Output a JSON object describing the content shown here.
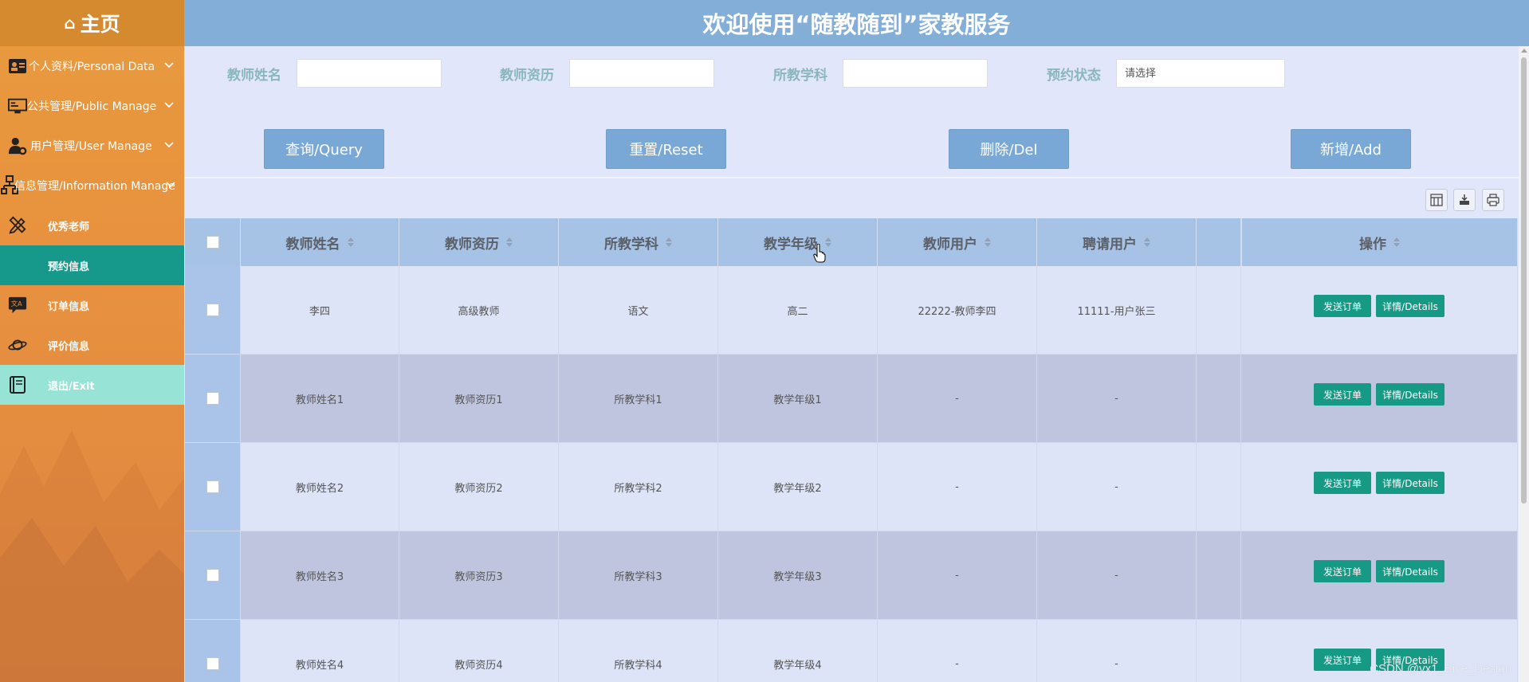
{
  "sidebar": {
    "home": "主页",
    "items": [
      {
        "label": "个人资料/Personal Data",
        "icon": "id-card-icon"
      },
      {
        "label": "公共管理/Public Manage",
        "icon": "monitor-icon"
      },
      {
        "label": "用户管理/User Manage",
        "icon": "user-gear-icon"
      },
      {
        "label": "信息管理/Information Manage",
        "icon": "sitemap-icon"
      }
    ],
    "sub_items": [
      {
        "label": "优秀老师",
        "icon": "pencil-ruler-icon"
      },
      {
        "label": "预约信息",
        "icon": ""
      },
      {
        "label": "订单信息",
        "icon": "translate-chat-icon"
      },
      {
        "label": "评价信息",
        "icon": "planet-icon"
      },
      {
        "label": "退出/Exit",
        "icon": "book-icon"
      }
    ]
  },
  "topbar": {
    "title": "欢迎使用“随教随到”家教服务"
  },
  "search": {
    "teacher_name_label": "教师姓名",
    "teacher_qual_label": "教师资历",
    "subject_label": "所教学科",
    "status_label": "预约状态",
    "status_placeholder": "请选择"
  },
  "actions": {
    "query": "查询/Query",
    "reset": "重置/Reset",
    "delete": "删除/Del",
    "add": "新增/Add"
  },
  "table": {
    "headers": [
      "教师姓名",
      "教师资历",
      "所教学科",
      "教学年级",
      "教师用户",
      "聘请用户",
      "操作"
    ],
    "rows": [
      [
        "李四",
        "高级教师",
        "语文",
        "高二",
        "22222-教师李四",
        "11111-用户张三"
      ],
      [
        "教师姓名1",
        "教师资历1",
        "所教学科1",
        "教学年级1",
        "-",
        "-"
      ],
      [
        "教师姓名2",
        "教师资历2",
        "所教学科2",
        "教学年级2",
        "-",
        "-"
      ],
      [
        "教师姓名3",
        "教师资历3",
        "所教学科3",
        "教学年级3",
        "-",
        "-"
      ],
      [
        "教师姓名4",
        "教师资历4",
        "所教学科4",
        "教学年级4",
        "-",
        "-"
      ]
    ],
    "row_actions": {
      "send": "发送订单",
      "details": "详情/Details"
    }
  },
  "watermark": "CSDN @vx1_Biye_Design",
  "colors": {
    "sidebar": "#e8913f",
    "topbar": "#82aed8",
    "accent": "#16998b",
    "action_button": "#7aa8d6",
    "table_header": "#a6c3e6"
  }
}
